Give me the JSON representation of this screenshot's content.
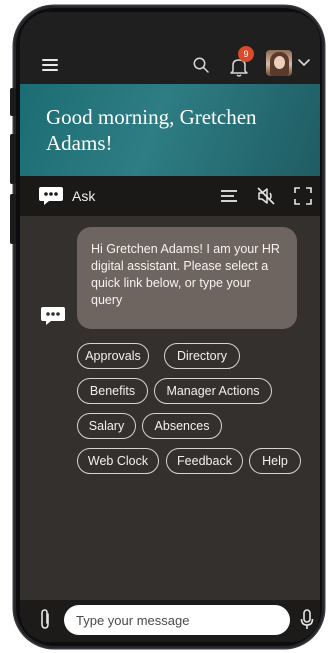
{
  "header": {
    "notification_count": "9"
  },
  "banner": {
    "greeting": "Good morning, Gretchen Adams!"
  },
  "askbar": {
    "label": "Ask"
  },
  "chat": {
    "bot_message": "Hi Gretchen Adams! I am your HR digital assistant. Please select a quick link below, or type your query",
    "quick_links": [
      "Approvals",
      "Directory",
      "Benefits",
      "Manager Actions",
      "Salary",
      "Absences",
      "Web Clock",
      "Feedback",
      "Help"
    ]
  },
  "composer": {
    "placeholder": "Type your message"
  },
  "colors": {
    "banner": "#2e7d84",
    "badge": "#d84a2a",
    "bubble": "#6e6561",
    "chat_bg": "#33302d"
  }
}
